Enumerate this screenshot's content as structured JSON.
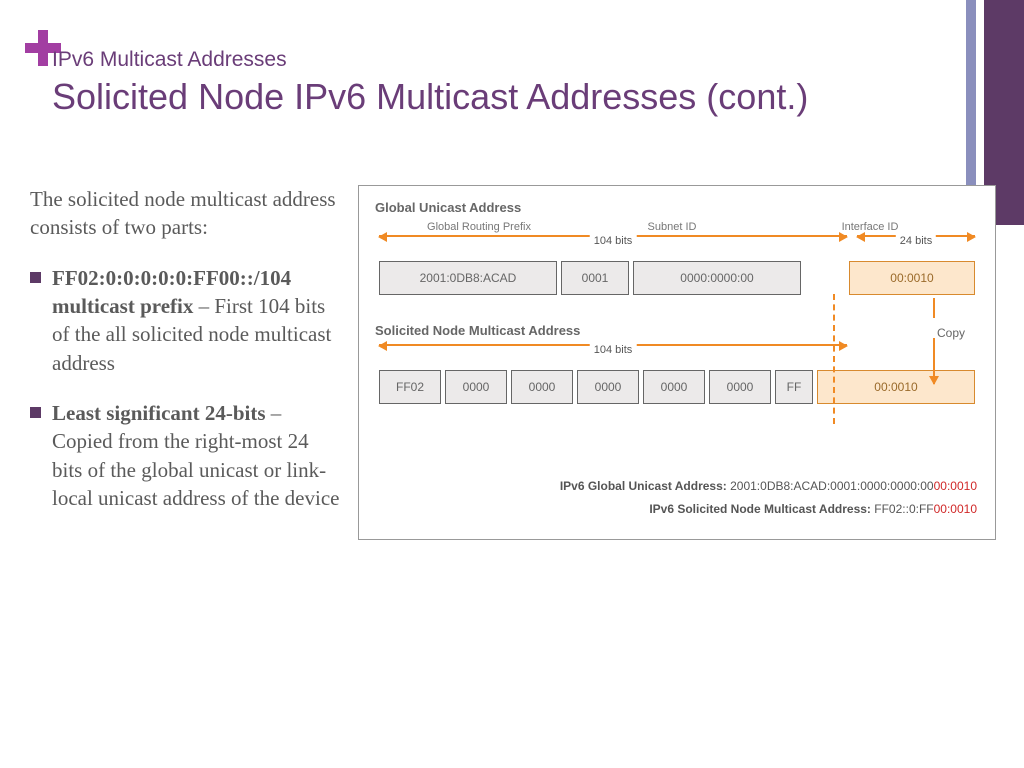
{
  "pre_title": "IPv6 Multicast Addresses",
  "main_title": "Solicited Node IPv6 Multicast Addresses (cont.)",
  "intro": "The solicited node multicast address consists of two parts:",
  "bullets": [
    {
      "bold": "FF02:0:0:0:0:0:FF00::/104 multicast prefix",
      "rest": " – First 104 bits of the all solicited node multicast address"
    },
    {
      "bold": "Least significant 24-bits",
      "rest": " – Copied from the right-most 24 bits of the global unicast or link-local unicast address of the device"
    }
  ],
  "diagram": {
    "sec1_title": "Global Unicast Address",
    "sub_labels": {
      "a": "Global Routing Prefix",
      "b": "Subnet ID",
      "c": "Interface ID"
    },
    "range104": "104 bits",
    "range24": "24 bits",
    "gua_blocks": [
      "2001:0DB8:ACAD",
      "0001",
      "0000:0000:00",
      "00:0010"
    ],
    "copy_label": "Copy",
    "sec2_title": "Solicited Node Multicast Address",
    "sn_blocks": [
      "FF02",
      "0000",
      "0000",
      "0000",
      "0000",
      "0000",
      "FF",
      "00:0010"
    ],
    "footer1_label": "IPv6 Global Unicast Address: ",
    "footer1_val": "2001:0DB8:ACAD:0001:0000:0000:00",
    "footer1_red": "00:0010",
    "footer2_label": "IPv6 Solicited Node Multicast Address: ",
    "footer2_val": "FF02::0:FF",
    "footer2_red": "00:0010"
  }
}
